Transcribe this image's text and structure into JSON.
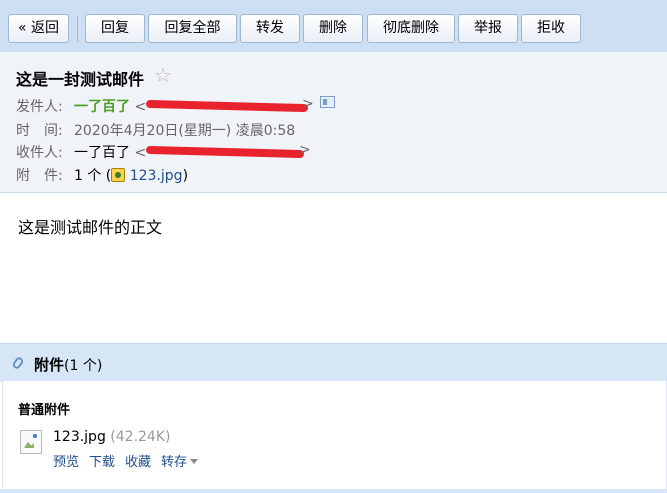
{
  "toolbar": {
    "back": "« 返回",
    "reply": "回复",
    "reply_all": "回复全部",
    "forward": "转发",
    "delete": "删除",
    "delete_permanently": "彻底删除",
    "report": "举报",
    "reject": "拒收"
  },
  "mail": {
    "subject": "这是一封测试邮件",
    "from_label": "发件人:",
    "from_name": "一了百了",
    "time_label": "时　间:",
    "time_value": "2020年4月20日(星期一) 凌晨0:58",
    "to_label": "收件人:",
    "to_name": "一了百了",
    "attach_label": "附　件:",
    "attach_count": "1 个 (",
    "attach_file": "123.jpg",
    "attach_close": ")",
    "body": "这是测试邮件的正文"
  },
  "attachments": {
    "title": "附件",
    "count": "(1 个)",
    "section": "普通附件",
    "file_name": "123.jpg",
    "file_size": "(42.24K)",
    "actions": {
      "preview": "预览",
      "download": "下载",
      "favorite": "收藏",
      "save_to": "转存"
    }
  }
}
